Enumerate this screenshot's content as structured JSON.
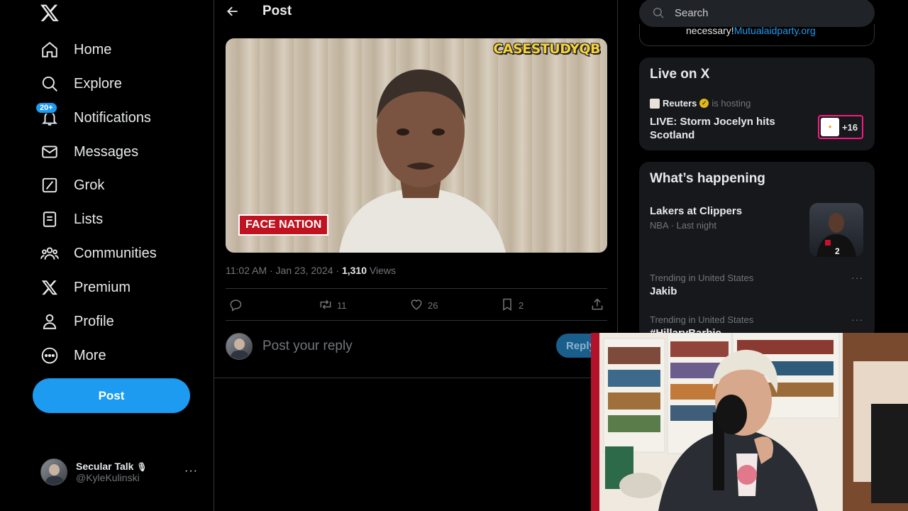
{
  "sidebar": {
    "logo": "x-logo-icon",
    "nav": [
      {
        "label": "Home",
        "icon": "home-icon"
      },
      {
        "label": "Explore",
        "icon": "search-icon"
      },
      {
        "label": "Notifications",
        "icon": "bell-icon",
        "badge": "20+"
      },
      {
        "label": "Messages",
        "icon": "mail-icon"
      },
      {
        "label": "Grok",
        "icon": "grok-icon"
      },
      {
        "label": "Lists",
        "icon": "list-icon"
      },
      {
        "label": "Communities",
        "icon": "people-icon"
      },
      {
        "label": "Premium",
        "icon": "x-logo-icon"
      },
      {
        "label": "Profile",
        "icon": "person-icon"
      },
      {
        "label": "More",
        "icon": "more-circle-icon"
      }
    ],
    "post_label": "Post",
    "account": {
      "name": "Secular Talk",
      "handle": "@KyleKulinski",
      "more": "···"
    }
  },
  "main": {
    "header_title": "Post",
    "video": {
      "watermark": "CASESTUDYQB",
      "channel_tag": "FACE NATION"
    },
    "meta": {
      "time": "11:02 AM · Jan 23, 2024 · ",
      "views": "1,310",
      "views_label": " Views"
    },
    "actions": {
      "reposts": "11",
      "likes": "26",
      "bookmarks": "2"
    },
    "reply_placeholder": "Post your reply",
    "reply_button": "Reply"
  },
  "right": {
    "search_placeholder": "Search",
    "cutoff_text": "necessary!",
    "cutoff_link": "Mutualaidparty.org",
    "live": {
      "title": "Live on X",
      "host": "Reuters",
      "host_suffix": "is hosting",
      "stream_title": "LIVE: Storm Jocelyn hits Scotland",
      "listeners": "+16"
    },
    "happening": {
      "title": "What’s happening",
      "items": [
        {
          "title": "Lakers at Clippers",
          "context": "NBA · Last night"
        },
        {
          "context": "Trending in United States",
          "title": "Jakib"
        },
        {
          "context": "Trending in United States",
          "title": "#HillaryBarbie"
        }
      ]
    }
  },
  "colors": {
    "accent": "#1d9bf0",
    "background": "#000000",
    "card": "#16181c",
    "muted": "#71767b",
    "live": "#f91880"
  }
}
